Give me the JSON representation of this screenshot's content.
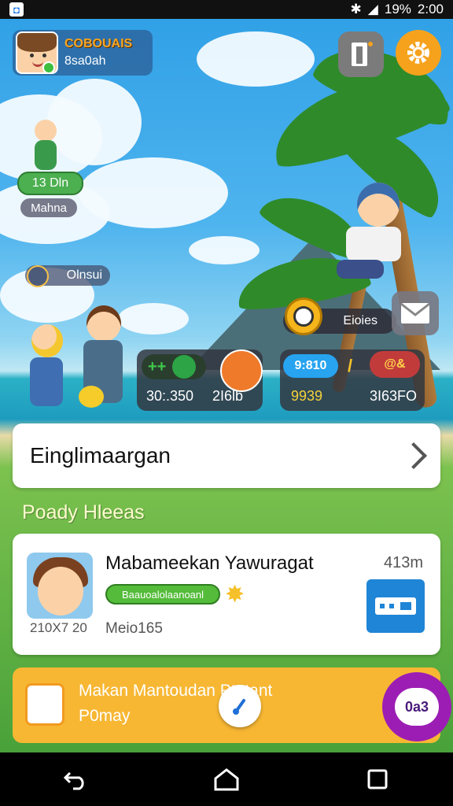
{
  "status_bar": {
    "battery": "19%",
    "time": "2:00"
  },
  "profile": {
    "name": "COBOUAIS",
    "subtitle": "8sa0ah",
    "avatar_icon": "girl-avatar-icon"
  },
  "top_buttons": {
    "exit_icon": "exit-door-icon",
    "settings_icon": "gear-icon"
  },
  "map_labels": {
    "green_pill": "13 Dln",
    "gray_pill": "Mahna",
    "tag_pill": "Olnsui"
  },
  "event": {
    "clock_label": "Eioies",
    "mail_icon": "mail-icon"
  },
  "stats_left": {
    "chip_text": "++",
    "value_a": "30:.350",
    "value_b": "2I6lb"
  },
  "stats_right": {
    "chip_blue": "9:810",
    "chip_red": "@&",
    "value_a": "9939",
    "value_b": "3I63FO"
  },
  "nav_card": {
    "title": "Einglimaargan"
  },
  "section": {
    "title": "Poady Hleeas"
  },
  "friend_card": {
    "name": "Mabameekan Yawuragat",
    "time": "413m",
    "xp_label": "Baauoalolaanoanl",
    "date": "210X7 20",
    "level": "Meio165",
    "action_icon": "ticket-icon"
  },
  "promo": {
    "title": "Makan Mantoudan Ptotant",
    "subtitle": "P0may",
    "chat_label": "0a3"
  },
  "colors": {
    "accent_orange": "#f6a21c",
    "promo_yellow": "#f7b733",
    "action_blue": "#1f85d6",
    "chat_purple": "#9c1db4",
    "xp_green": "#54bc3a"
  }
}
